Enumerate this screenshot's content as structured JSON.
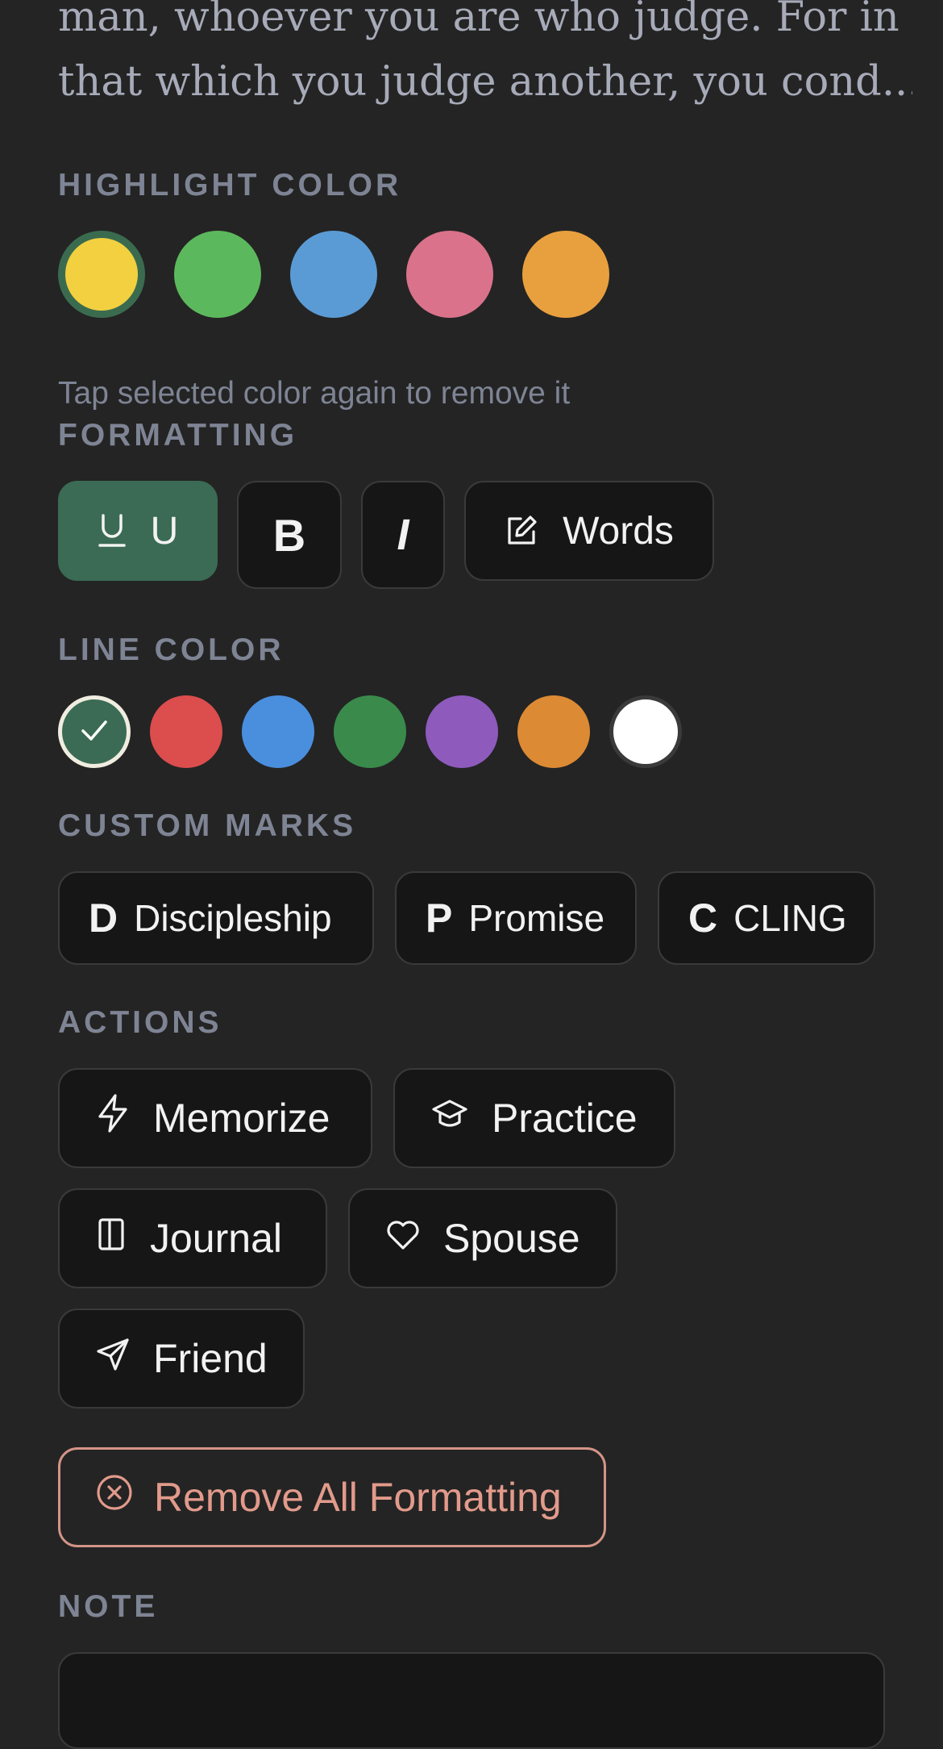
{
  "verse": {
    "line1": "man, whoever you are who judge. For in",
    "line2": "that which you judge another, you cond..."
  },
  "highlight": {
    "label": "HIGHLIGHT COLOR",
    "colors": [
      "#f2d03f",
      "#5cb85c",
      "#5b9bd5",
      "#d9728a",
      "#e8a03e"
    ],
    "selected_index": 0,
    "hint": "Tap selected color again to remove it"
  },
  "formatting": {
    "label": "FORMATTING",
    "underline_label": "U",
    "bold_label": "B",
    "italic_label": "I",
    "words_label": "Words"
  },
  "line_color": {
    "label": "LINE COLOR",
    "colors": [
      "#3b6b54",
      "#dc4d4d",
      "#4a8fde",
      "#3a8a4c",
      "#8e5bbd",
      "#dd8a35",
      "#ffffff"
    ],
    "selected_index": 0
  },
  "custom_marks": {
    "label": "CUSTOM MARKS",
    "items": [
      {
        "letter": "D",
        "label": "Discipleship"
      },
      {
        "letter": "P",
        "label": "Promise"
      },
      {
        "letter": "C",
        "label": "CLING"
      }
    ]
  },
  "actions": {
    "label": "ACTIONS",
    "memorize": "Memorize",
    "practice": "Practice",
    "journal": "Journal",
    "spouse": "Spouse",
    "friend": "Friend",
    "remove_all": "Remove All Formatting"
  },
  "note": {
    "label": "NOTE"
  }
}
